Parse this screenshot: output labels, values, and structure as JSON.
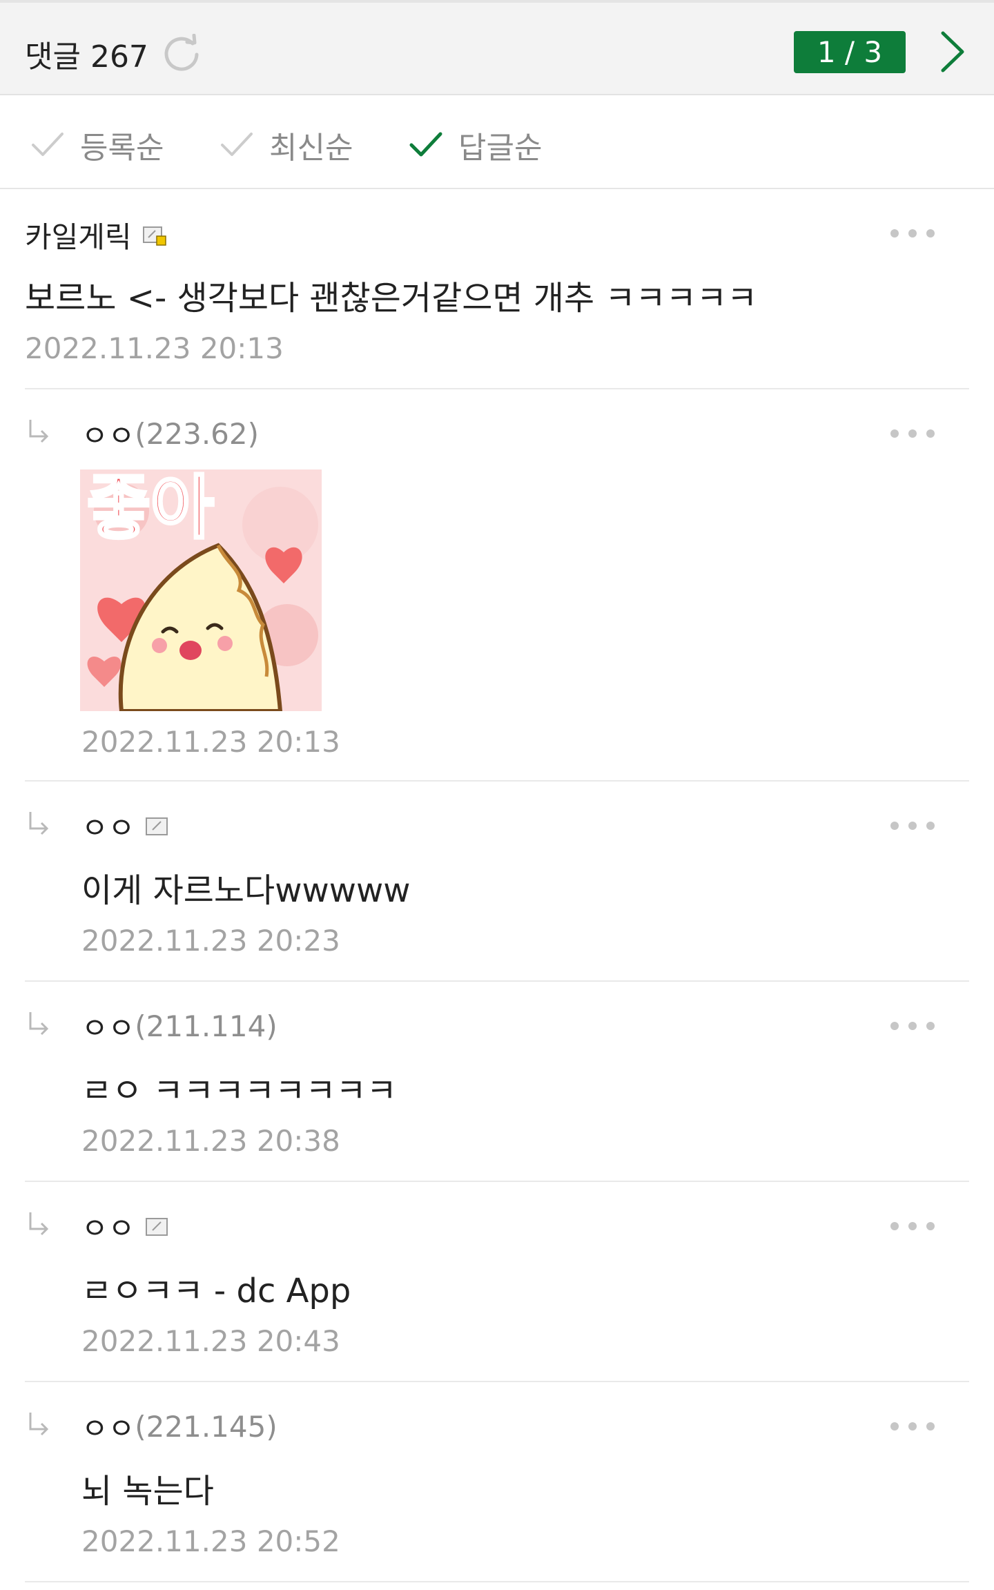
{
  "header": {
    "title": "댓글 267",
    "page_indicator": "1 / 3"
  },
  "sort": {
    "options": [
      {
        "label": "등록순"
      },
      {
        "label": "최신순"
      },
      {
        "label": "답글순"
      }
    ],
    "colors": {
      "inactive": "#c9c9c9",
      "active": "#0e7d3a"
    }
  },
  "comments": [
    {
      "author": "카일게릭",
      "ip": "",
      "text": "보르노 <- 생각보다 괜찮은거같으면 개추 ㅋㅋㅋㅋㅋ",
      "date": "2022.11.23 20:13"
    },
    {
      "author": "ㅇㅇ",
      "ip": "(223.62)",
      "sticker": "좋아",
      "date": "2022.11.23 20:13"
    },
    {
      "author": "ㅇㅇ",
      "ip": "",
      "text": "이게 자르노다wwwww",
      "date": "2022.11.23 20:23"
    },
    {
      "author": "ㅇㅇ",
      "ip": "(211.114)",
      "text": "ㄹㅇ ㅋㅋㅋㅋㅋㅋㅋㅋ",
      "date": "2022.11.23 20:38"
    },
    {
      "author": "ㅇㅇ",
      "ip": "",
      "text": "ㄹㅇㅋㅋ - dc App",
      "date": "2022.11.23 20:43"
    },
    {
      "author": "ㅇㅇ",
      "ip": "(221.145)",
      "text": "뇌 녹는다",
      "date": "2022.11.23 20:52"
    }
  ],
  "icons": {
    "refresh": "refresh-icon",
    "next": "chevron-right-icon",
    "more": "more-dots-icon",
    "reply": "reply-arrow-icon",
    "member": "member-badge-icon"
  },
  "colors": {
    "accent": "#0e7d3a"
  }
}
